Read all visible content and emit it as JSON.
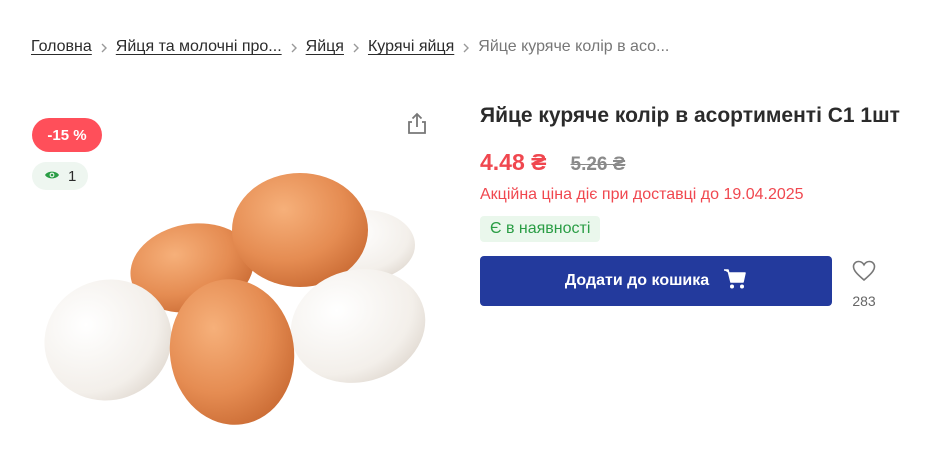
{
  "breadcrumb": {
    "items": [
      {
        "label": "Головна"
      },
      {
        "label": "Яйця та молочні про..."
      },
      {
        "label": "Яйця"
      },
      {
        "label": "Курячі яйця"
      },
      {
        "label": "Яйце куряче колір в асо..."
      }
    ]
  },
  "badges": {
    "discount": "-15 %",
    "views": "1"
  },
  "product": {
    "title": "Яйце куряче колір в асортименті С1 1шт",
    "price_new": "4.48 ₴",
    "price_old": "5.26 ₴",
    "promo_text": "Акційна ціна діє при доставці до 19.04.2025",
    "stock_text": "Є в наявності",
    "cart_button_label": "Додати до кошика",
    "wishlist_count": "283"
  },
  "icons": {
    "share": "share-icon",
    "eye": "eye-icon",
    "cart": "cart-icon",
    "heart": "heart-icon",
    "chevron": "chevron-right-icon"
  },
  "colors": {
    "accent_red": "#f0474f",
    "button_blue": "#233a9d",
    "stock_green": "#2a9d45"
  }
}
